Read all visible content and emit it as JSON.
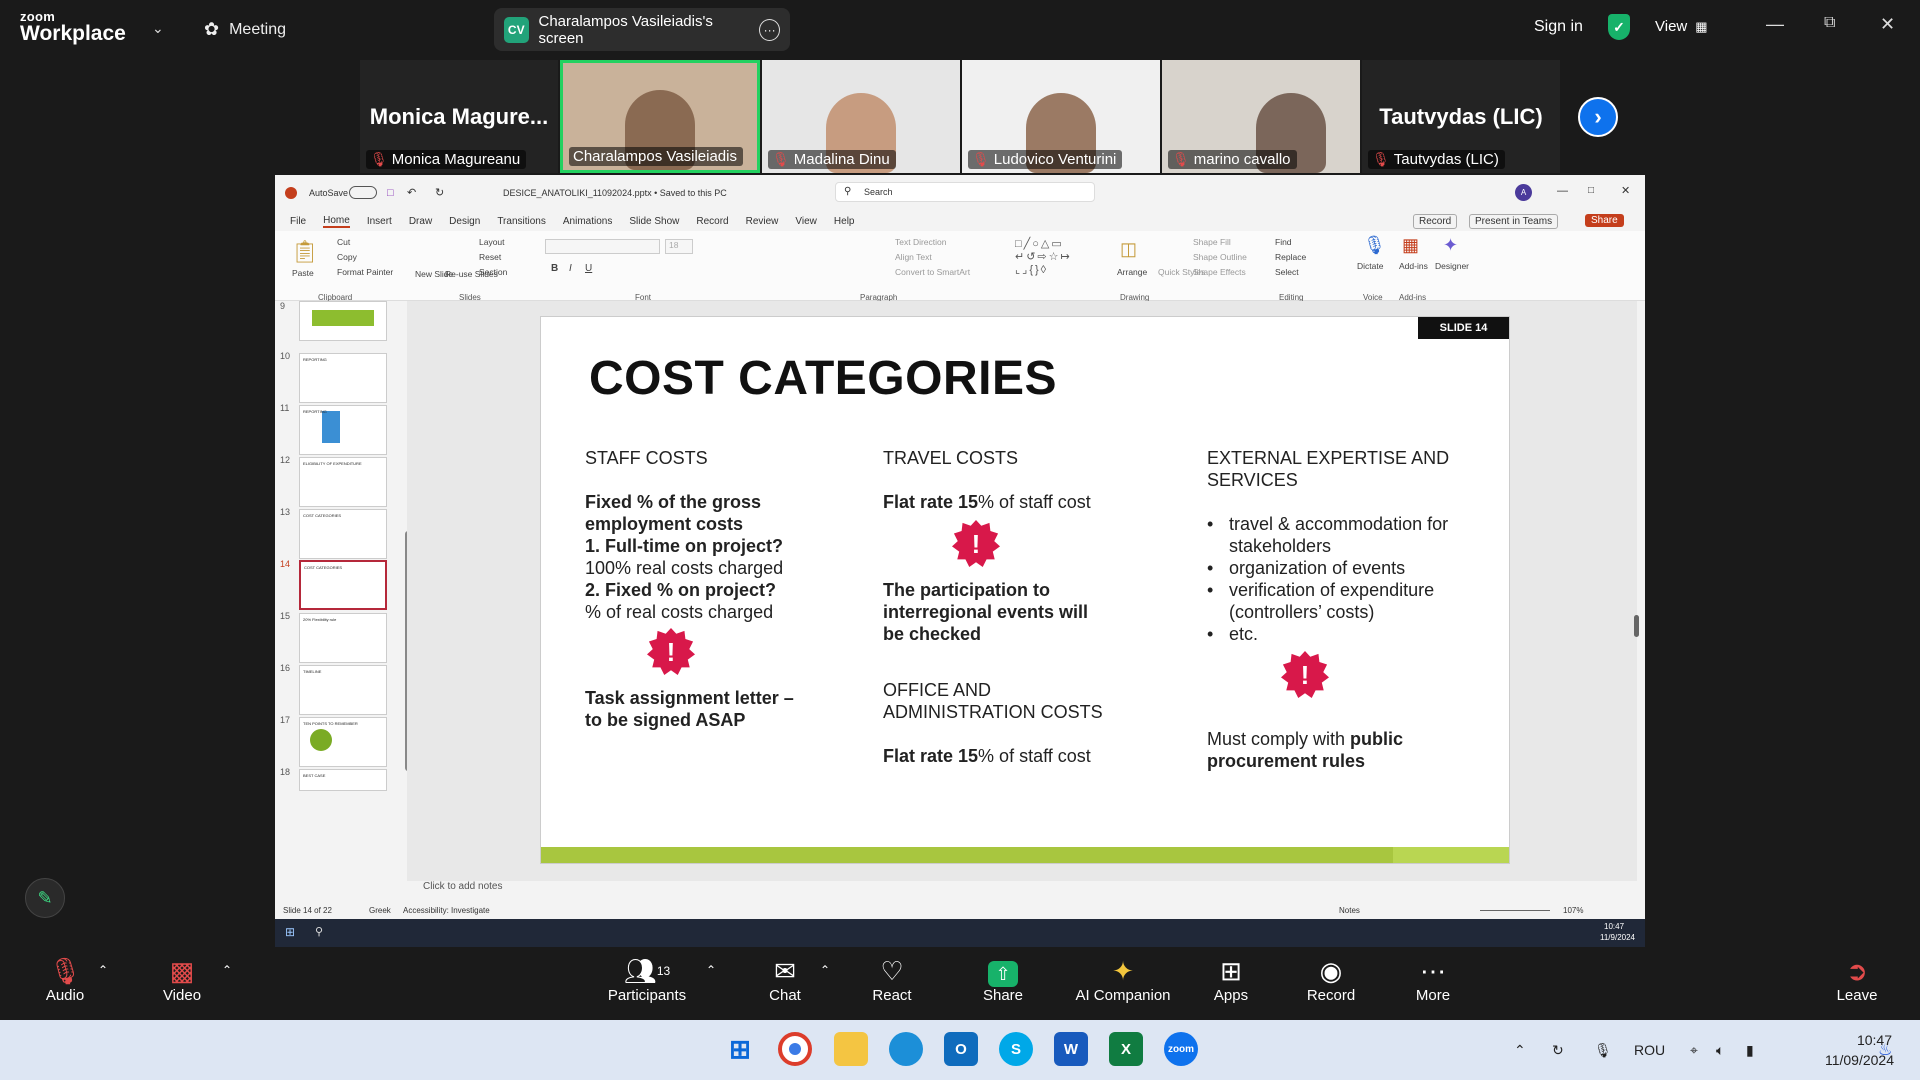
{
  "app": {
    "logo_top": "zoom",
    "logo_bottom": "Workplace",
    "meeting_label": "Meeting",
    "screen_initials": "CV",
    "screen_title": "Charalampos Vasileiadis's screen",
    "sign_in": "Sign in",
    "view": "View"
  },
  "gallery": [
    {
      "big": "Monica  Magure...",
      "name": "Monica Magureanu",
      "kind": "text"
    },
    {
      "name": "Charalampos Vasileiadis",
      "kind": "video",
      "bg": "#c9b29a",
      "face": "#8a6a52"
    },
    {
      "name": "Madalina Dinu",
      "kind": "video",
      "bg": "#e6e6e6",
      "face": "#c79c80"
    },
    {
      "name": "Ludovico Venturini",
      "kind": "video",
      "bg": "#f0f0f0",
      "face": "#9b7a64"
    },
    {
      "name": "marino cavallo",
      "kind": "video",
      "bg": "#d8d3cc",
      "face": "#7b665a"
    },
    {
      "big": "Tautvydas (LIC)",
      "name": "Tautvydas (LIC)",
      "kind": "text"
    }
  ],
  "ppt": {
    "autosave": "AutoSave",
    "filename": "DESICE_ANATOLIKI_11092024.pptx  •  Saved to this PC",
    "search": "Search",
    "user_initial": "A",
    "record_btn": "Record",
    "present_btn": "Present in Teams",
    "share_btn": "Share",
    "menu": [
      "File",
      "Home",
      "Insert",
      "Draw",
      "Design",
      "Transitions",
      "Animations",
      "Slide Show",
      "Record",
      "Review",
      "View",
      "Help"
    ],
    "ribbon_groups": [
      "Clipboard",
      "Slides",
      "Font",
      "Paragraph",
      "Drawing",
      "Editing",
      "Voice",
      "Add-ins"
    ],
    "ribbon_items": {
      "paste": "Paste",
      "cut": "Cut",
      "copy": "Copy",
      "format_painter": "Format Painter",
      "new_slide": "New Slide",
      "reuse": "Re-use Slides",
      "layout": "Layout",
      "reset": "Reset",
      "section": "Section",
      "arrange": "Arrange",
      "quick_styles": "Quick Styles",
      "find": "Find",
      "replace": "Replace",
      "select": "Select",
      "dictate": "Dictate",
      "addins": "Add-ins",
      "designer": "Designer",
      "font_size": "18",
      "text_direction": "Text Direction",
      "align_text": "Align Text",
      "smartart": "Convert to SmartArt",
      "shape_fill": "Shape Fill",
      "shape_outline": "Shape Outline",
      "shape_effects": "Shape Effects"
    },
    "thumb_numbers": [
      "9",
      "10",
      "11",
      "12",
      "13",
      "14",
      "15",
      "16",
      "17",
      "18"
    ],
    "thumb_titles": [
      "",
      "REPORTING",
      "REPORTING",
      "ELIGIBILITY OF EXPENDITURE",
      "COST CATEGORIES",
      "COST CATEGORIES",
      "20% Flexibility rule",
      "TIMELINE",
      "TEN POINTS TO REMEMBER",
      "BEST CASE"
    ],
    "notes": "Click to add notes",
    "status_slide": "Slide 14 of 22",
    "status_lang": "Greek",
    "status_access": "Accessibility: Investigate",
    "status_notes": "Notes",
    "zoom": "107%",
    "time_small": "10:47",
    "date_small": "11/9/2024"
  },
  "slide": {
    "tag": "SLIDE 14",
    "title": "COST CATEGORIES",
    "staff_head": "STAFF COSTS",
    "staff_b1": "Fixed % of the gross employment costs",
    "staff_b2": "1. Full-time on project?",
    "staff_t1": "100% real costs charged",
    "staff_b3": "2. Fixed % on project?",
    "staff_t2": "% of real costs charged",
    "staff_task": "Task assignment letter – to be signed ASAP",
    "travel_head": "TRAVEL COSTS",
    "travel_rate_b": "Flat rate 15",
    "travel_rate_t": "% of staff cost",
    "travel_note": "The participation to interregional events will be checked",
    "office_head": "OFFICE AND ADMINISTRATION COSTS",
    "office_rate_b": "Flat rate 15",
    "office_rate_t": "% of staff cost",
    "ext_head": "EXTERNAL EXPERTISE AND SERVICES",
    "ext_items": [
      "travel & accommodation for stakeholders",
      "organization of events",
      "verification of expenditure (controllers’ costs)",
      "etc."
    ],
    "ext_comply_t": "Must comply with ",
    "ext_comply_b": "public procurement rules",
    "warn_glyph": "!"
  },
  "toolbar": {
    "audio": "Audio",
    "video": "Video",
    "participants": "Participants",
    "participant_count": "13",
    "chat": "Chat",
    "react": "React",
    "share": "Share",
    "ai": "AI Companion",
    "apps": "Apps",
    "record": "Record",
    "more": "More",
    "leave": "Leave"
  },
  "tray": {
    "lang": "ROU",
    "time": "10:47",
    "date": "11/09/2024"
  },
  "colors": {
    "accent_green": "#a8c63f",
    "warn_red": "#d8184a",
    "zoom_blue": "#0e72ed",
    "share_green": "#17b26a"
  }
}
